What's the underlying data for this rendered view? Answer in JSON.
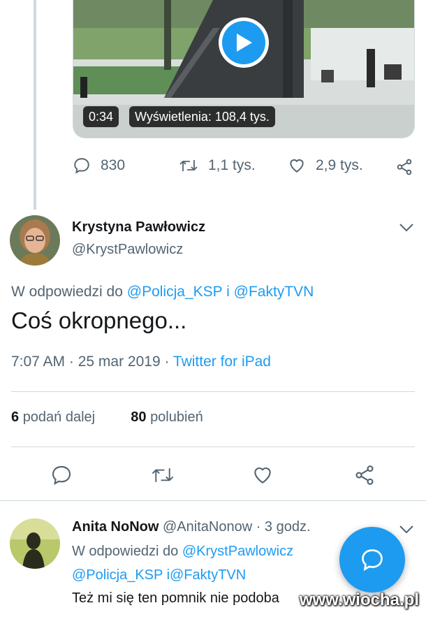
{
  "video": {
    "duration": "0:34",
    "views": "Wyświetlenia: 108,4 tys."
  },
  "quoted_actions": {
    "replies": "830",
    "retweets": "1,1 tys.",
    "likes": "2,9 tys."
  },
  "tweet": {
    "author_name": "Krystyna Pawłowicz",
    "author_handle": "@KrystPawlowicz",
    "reply_prefix": "W odpowiedzi do",
    "reply_user1": "@Policja_KSP",
    "reply_and": "i",
    "reply_user2": "@FaktyTVN",
    "text": "Coś okropnego...",
    "time": "7:07 AM · 25 mar 2019 ·",
    "source": "Twitter for iPad",
    "retweet_count": "6",
    "retweet_label": "podań dalej",
    "like_count": "80",
    "like_label": "polubień"
  },
  "reply": {
    "author_name": "Anita NoNow",
    "author_handle": "@AnitaNonow",
    "time": "· 3 godz.",
    "reply_prefix": "W odpowiedzi do",
    "reply_user1": "@KrystPawlowicz",
    "reply_user2": "@Policja_KSP",
    "reply_and_user3": "i@FaktyTVN",
    "text": "Też mi się ten pomnik nie podoba"
  },
  "watermark": "www.wiocha.pl",
  "colors": {
    "accent": "#1d9bf0",
    "secondary_text": "#536471",
    "divider": "#cfd9de"
  },
  "icons": [
    "play-icon",
    "reply-icon",
    "retweet-icon",
    "like-icon",
    "share-icon",
    "chevron-down-icon",
    "compose-reply-icon"
  ]
}
